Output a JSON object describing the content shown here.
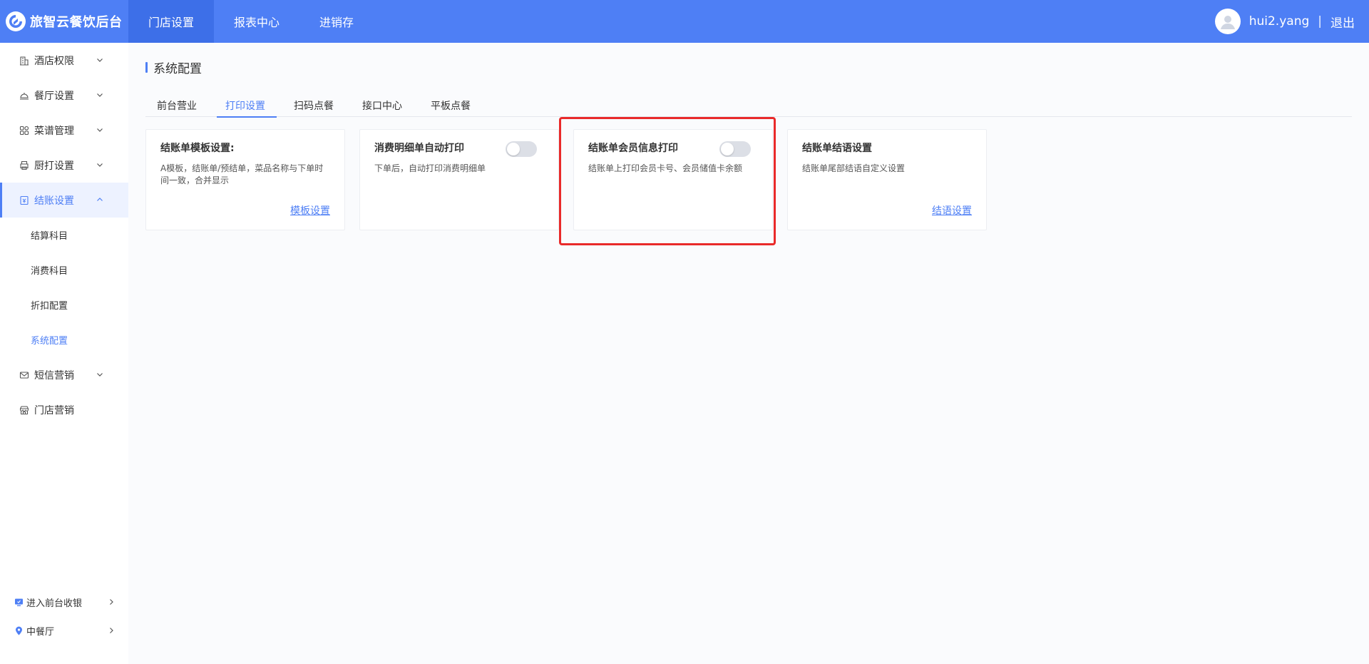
{
  "brand": {
    "name": "旅智云餐饮后台"
  },
  "topnav": [
    {
      "label": "门店设置",
      "active": true
    },
    {
      "label": "报表中心",
      "active": false
    },
    {
      "label": "进销存",
      "active": false
    }
  ],
  "user": {
    "name": "hui2.yang",
    "separator": "|",
    "logout": "退出"
  },
  "sidebar": {
    "items": [
      {
        "label": "酒店权限",
        "icon": "building-icon"
      },
      {
        "label": "餐厅设置",
        "icon": "dish-cover-icon"
      },
      {
        "label": "菜谱管理",
        "icon": "grid-icon"
      },
      {
        "label": "厨打设置",
        "icon": "printer-icon"
      },
      {
        "label": "结账设置",
        "icon": "receipt-icon",
        "open": true
      },
      {
        "label": "短信营销",
        "icon": "mail-icon"
      },
      {
        "label": "门店营销",
        "icon": "store-icon"
      }
    ],
    "subitems": [
      {
        "label": "结算科目"
      },
      {
        "label": "消费科目"
      },
      {
        "label": "折扣配置"
      },
      {
        "label": "系统配置",
        "active": true
      }
    ],
    "bottom": [
      {
        "label": "进入前台收银",
        "icon": "monitor-icon"
      },
      {
        "label": "中餐厅",
        "icon": "location-pin-icon"
      }
    ]
  },
  "page": {
    "title": "系统配置"
  },
  "tabs": [
    {
      "label": "前台营业"
    },
    {
      "label": "打印设置",
      "active": true
    },
    {
      "label": "扫码点餐"
    },
    {
      "label": "接口中心"
    },
    {
      "label": "平板点餐"
    }
  ],
  "cards": [
    {
      "title": "结账单模板设置:",
      "desc": "A模板，结账单/预结单，菜品名称与下单时间一致，合并显示",
      "link": "模板设置"
    },
    {
      "title": "消费明细单自动打印",
      "desc": "下单后，自动打印消费明细单",
      "toggle": false
    },
    {
      "title": "结账单会员信息打印",
      "desc": "结账单上打印会员卡号、会员储值卡余额",
      "toggle": false
    },
    {
      "title": "结账单结语设置",
      "desc": "结账单尾部结语自定义设置",
      "link": "结语设置"
    }
  ],
  "colors": {
    "primary": "#4e7ff5",
    "highlight": "#e92a2a"
  }
}
